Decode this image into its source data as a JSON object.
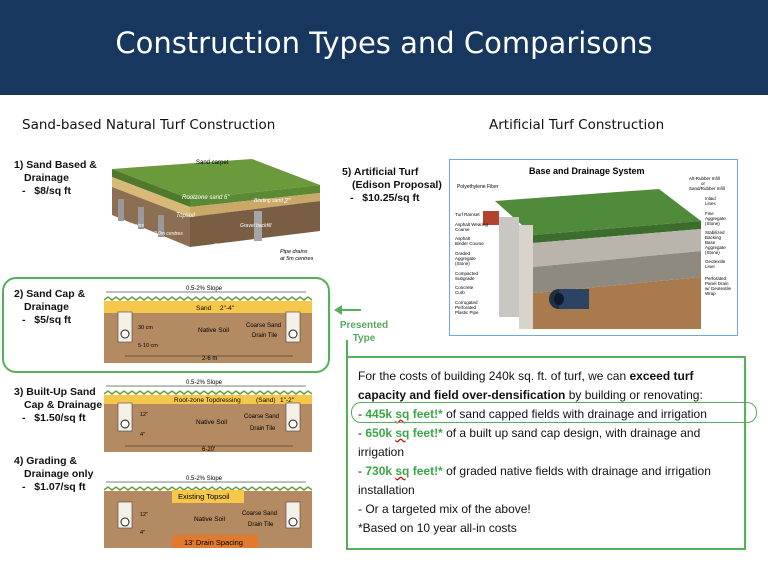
{
  "title": "Construction Types and Comparisons",
  "left_heading": "Sand-based Natural Turf Construction",
  "right_heading": "Artificial Turf Construction",
  "items": [
    {
      "label1": "1) Sand Based &",
      "label2": "Drainage",
      "price_dash": "-",
      "price": "$8/sq ft"
    },
    {
      "label1": "2) Sand Cap &",
      "label2": "Drainage",
      "price_dash": "-",
      "price": "$5/sq ft"
    },
    {
      "label1": "3) Built-Up Sand",
      "label2": "Cap & Drainage",
      "price_dash": "-",
      "price": "$1.50/sq ft"
    },
    {
      "label1": "4) Grading &",
      "label2": "Drainage only",
      "price_dash": "-",
      "price": "$1.07/sq ft"
    },
    {
      "label1": "5) Artificial Turf",
      "label2": "(Edison Proposal)",
      "price_dash": "-",
      "price": "$10.25/sq ft"
    }
  ],
  "diagram1": {
    "sand_carpet": "Sand carpet",
    "rootzone": "Rootzone sand 6\"",
    "topsoil": "Topsoil",
    "binding": "Binding sand",
    "two_in": "2\"",
    "gravel": "Gravel backfill",
    "silt1": "Silt drains",
    "silt2": "Typically at 1.0 to 2.0m centres",
    "subsoil": "Subsoil",
    "pipe1": "Pipe drains",
    "pipe2": "at 5m centres"
  },
  "diagram2": {
    "slope": "0.5-2% Slope",
    "sand": "Sand",
    "sand_depth": "2\"-4\"",
    "native": "Native Soil",
    "coarse": "Coarse Sand",
    "tile": "Drain Tile",
    "d1": "30 cm",
    "d2": "5-10 cm",
    "span": "2-6 m"
  },
  "diagram3": {
    "slope": "0.5-2% Slope",
    "rootzone": "Root-zone Topdressing",
    "sand": "(Sand)",
    "depth": "1\"-2\"",
    "native": "Native Soil",
    "coarse": "Coarse Sand",
    "tile": "Drain Tile",
    "d1": "12\"",
    "d2": "4\"",
    "span": "6-20'"
  },
  "diagram4": {
    "slope": "0.5-2% Slope",
    "topsoil": "Existing Topsoil",
    "native": "Native Soil",
    "coarse": "Coarse Sand",
    "tile": "Drain Tile",
    "d1": "12\"",
    "d2": "4\"",
    "spacing": "13' Drain Spacing"
  },
  "artificial": {
    "title": "Base and Drainage System",
    "fiber": "Polyethylene Fiber",
    "infill": [
      "Alt-Rubber Infill",
      "or",
      "Sand/Rubber Infill"
    ],
    "inlaid": [
      "Inlaid",
      "Lines"
    ],
    "fine": [
      "Fine",
      "Aggregate",
      "(Stone)"
    ],
    "backing": [
      "Stabilized",
      "Backing",
      "Base",
      "Aggregate",
      "(Stone)"
    ],
    "geo": [
      "Geotextile",
      "Liner"
    ],
    "panel": [
      "Perforated",
      "Panel Drain",
      "w/ Geotextile",
      "Wrap"
    ],
    "ramset": "Turf Ramset",
    "asphalt_wear": [
      "Asphalt Wearing",
      "Course"
    ],
    "asphalt_binder": [
      "Asphalt",
      "Binder Course"
    ],
    "graded": [
      "Graded",
      "Aggregate",
      "(Stone)"
    ],
    "compacted": [
      "Compacted",
      "Subgrade"
    ],
    "curb": [
      "Concrete",
      "Curb"
    ],
    "pipe": [
      "Corrugated",
      "Perforated",
      "Plastic Pipe"
    ]
  },
  "presented": {
    "line1": "Presented",
    "line2": "Type"
  },
  "info": {
    "intro_a": "For the costs of building 240k sq. ft. of turf, we can ",
    "intro_bold": "exceed turf capacity and field over-densification",
    "intro_b": " by building or renovating:",
    "b1_dash": " - ",
    "b1_num": "445k ",
    "b1_sq": "sq",
    "b1_feet": " feet!*",
    "b1_rest": " of sand capped fields with drainage and irrigation",
    "b2_dash": " - ",
    "b2_num": "650k ",
    "b2_sq": "sq",
    "b2_feet": " feet!*",
    "b2_rest": " of a built up sand cap design, with drainage and irrigation",
    "b3_dash": " - ",
    "b3_num": "730k ",
    "b3_sq": "sq",
    "b3_feet": " feet!*",
    "b3_rest": " of graded native fields with drainage and irrigation installation",
    "b4": " - Or a targeted mix of the above!",
    "note": "*Based on 10 year all-in costs"
  },
  "colors": {
    "banner": "#17375e",
    "accent_green": "#55b05c",
    "highlight_green": "#3aa748",
    "soil": "#b38a62",
    "sand": "#f5c84c"
  }
}
